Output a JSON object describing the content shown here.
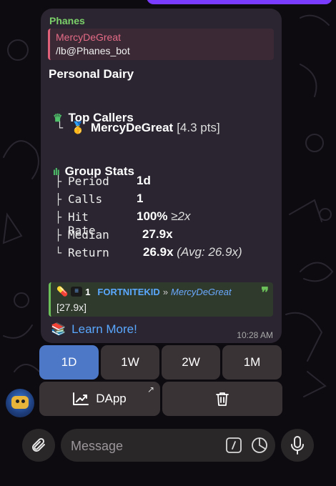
{
  "message": {
    "sender": "Phanes",
    "reply": {
      "name": "MercyDeGreat",
      "text": "/lb@Phanes_bot"
    },
    "title": "Personal Dairy",
    "top_callers": {
      "heading": "Top Callers",
      "tree": "└",
      "name": "MercyDeGreat",
      "points": "[4.3 pts]"
    },
    "group_stats": {
      "heading": "Group Stats",
      "rows": [
        {
          "tree": "├",
          "label": "Period",
          "value": "1d",
          "extra": ""
        },
        {
          "tree": "├",
          "label": "Calls",
          "value": "1",
          "extra": ""
        },
        {
          "tree": "├",
          "label": "Hit Rate",
          "value": "100%",
          "extra": "≥2x"
        },
        {
          "tree": "├",
          "label": "Median",
          "value": "27.9x",
          "extra": ""
        },
        {
          "tree": "└",
          "label": "Return",
          "value": "26.9x",
          "extra": "(Avg: 26.9x)"
        }
      ]
    },
    "quote": {
      "count": "1",
      "token": "FORTNITEKID",
      "separator": "»",
      "user": "MercyDeGreat",
      "multiplier": "[27.9x]"
    },
    "learn_more": "Learn More!",
    "time": "10:28 AM"
  },
  "keyboard": {
    "row1": [
      "1D",
      "1W",
      "2W",
      "1M"
    ],
    "dapp_label": "DApp"
  },
  "composer": {
    "placeholder": "Message"
  },
  "colors": {
    "accent_green": "#7bd06a",
    "link_blue": "#5aa8ff",
    "active_button": "#4d78c8"
  },
  "icons": [
    "crown-icon",
    "medal-icon",
    "stats-icon",
    "books-icon",
    "chart-icon",
    "external-link-icon",
    "trash-icon",
    "attach-icon",
    "slash-command-icon",
    "timer-icon",
    "mic-icon"
  ]
}
